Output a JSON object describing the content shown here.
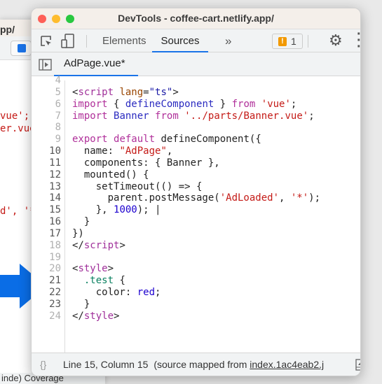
{
  "background_window": {
    "title_fragment": "pp/",
    "code_fragments": [
      "vue';",
      "er.vue",
      "d', '*"
    ],
    "status_fragment": "inde) Coverage"
  },
  "window": {
    "title": "DevTools - coffee-cart.netlify.app/"
  },
  "toolbar": {
    "tabs": [
      {
        "label": "Elements",
        "active": false
      },
      {
        "label": "Sources",
        "active": true
      }
    ],
    "more": "»",
    "issues_count": "1",
    "accent": "#1a73e8"
  },
  "editor_tab": {
    "label": "AdPage.vue*",
    "close": "×"
  },
  "code": {
    "lines": [
      {
        "n": "4",
        "mapped": false,
        "tokens": []
      },
      {
        "n": "5",
        "mapped": false,
        "tokens": [
          [
            "<",
            ""
          ],
          [
            "script",
            "t-tag"
          ],
          [
            " ",
            ""
          ],
          [
            "lang",
            "t-attr"
          ],
          [
            "=",
            ""
          ],
          [
            "\"ts\"",
            "t-aval"
          ],
          [
            ">",
            ""
          ]
        ]
      },
      {
        "n": "6",
        "mapped": false,
        "tokens": [
          [
            "import",
            "t-kw"
          ],
          [
            " { ",
            ""
          ],
          [
            "defineComponent",
            "t-def"
          ],
          [
            " } ",
            ""
          ],
          [
            "from",
            "t-kw"
          ],
          [
            " ",
            ""
          ],
          [
            "'vue'",
            "t-str"
          ],
          [
            ";",
            ""
          ]
        ]
      },
      {
        "n": "7",
        "mapped": false,
        "tokens": [
          [
            "import",
            "t-kw"
          ],
          [
            " ",
            ""
          ],
          [
            "Banner",
            "t-def"
          ],
          [
            " ",
            ""
          ],
          [
            "from",
            "t-kw"
          ],
          [
            " ",
            ""
          ],
          [
            "'../parts/Banner.vue'",
            "t-str"
          ],
          [
            ";",
            ""
          ]
        ]
      },
      {
        "n": "8",
        "mapped": false,
        "tokens": []
      },
      {
        "n": "9",
        "mapped": false,
        "tokens": [
          [
            "export",
            "t-kw"
          ],
          [
            " ",
            ""
          ],
          [
            "default",
            "t-kw"
          ],
          [
            " defineComponent({",
            ""
          ]
        ]
      },
      {
        "n": "10",
        "mapped": true,
        "tokens": [
          [
            "  name: ",
            ""
          ],
          [
            "\"AdPage\"",
            "t-str"
          ],
          [
            ",",
            ""
          ]
        ]
      },
      {
        "n": "11",
        "mapped": true,
        "tokens": [
          [
            "  components: { Banner },",
            ""
          ]
        ]
      },
      {
        "n": "12",
        "mapped": true,
        "tokens": [
          [
            "  mounted() {",
            ""
          ]
        ]
      },
      {
        "n": "13",
        "mapped": true,
        "tokens": [
          [
            "    setTimeout(() => {",
            ""
          ]
        ]
      },
      {
        "n": "14",
        "mapped": true,
        "tokens": [
          [
            "      parent.postMessage(",
            ""
          ],
          [
            "'AdLoaded'",
            "t-str"
          ],
          [
            ", ",
            ""
          ],
          [
            "'*'",
            "t-str"
          ],
          [
            ");",
            ""
          ]
        ]
      },
      {
        "n": "15",
        "mapped": true,
        "tokens": [
          [
            "    }, ",
            ""
          ],
          [
            "1000",
            "t-num"
          ],
          [
            "); |",
            ""
          ]
        ]
      },
      {
        "n": "16",
        "mapped": true,
        "tokens": [
          [
            "  }",
            ""
          ]
        ]
      },
      {
        "n": "17",
        "mapped": true,
        "tokens": [
          [
            "})",
            ""
          ]
        ]
      },
      {
        "n": "18",
        "mapped": false,
        "tokens": [
          [
            "</",
            ""
          ],
          [
            "script",
            "t-tag"
          ],
          [
            ">",
            ""
          ]
        ]
      },
      {
        "n": "19",
        "mapped": false,
        "tokens": []
      },
      {
        "n": "20",
        "mapped": false,
        "tokens": [
          [
            "<",
            ""
          ],
          [
            "style",
            "t-tag"
          ],
          [
            ">",
            ""
          ]
        ]
      },
      {
        "n": "21",
        "mapped": true,
        "tokens": [
          [
            "  ",
            ""
          ],
          [
            ".test",
            "t-cls"
          ],
          [
            " {",
            ""
          ]
        ]
      },
      {
        "n": "22",
        "mapped": true,
        "tokens": [
          [
            "    color: ",
            ""
          ],
          [
            "red",
            "t-num"
          ],
          [
            ";",
            ""
          ]
        ]
      },
      {
        "n": "23",
        "mapped": true,
        "tokens": [
          [
            "  }",
            ""
          ]
        ]
      },
      {
        "n": "24",
        "mapped": false,
        "tokens": [
          [
            "</",
            ""
          ],
          [
            "style",
            "t-tag"
          ],
          [
            ">",
            ""
          ]
        ]
      }
    ]
  },
  "status": {
    "braces": "{}",
    "position": "Line 15, Column 15",
    "mapped_prefix": "(source mapped from ",
    "mapped_link": "index.1ac4eab2.j"
  }
}
